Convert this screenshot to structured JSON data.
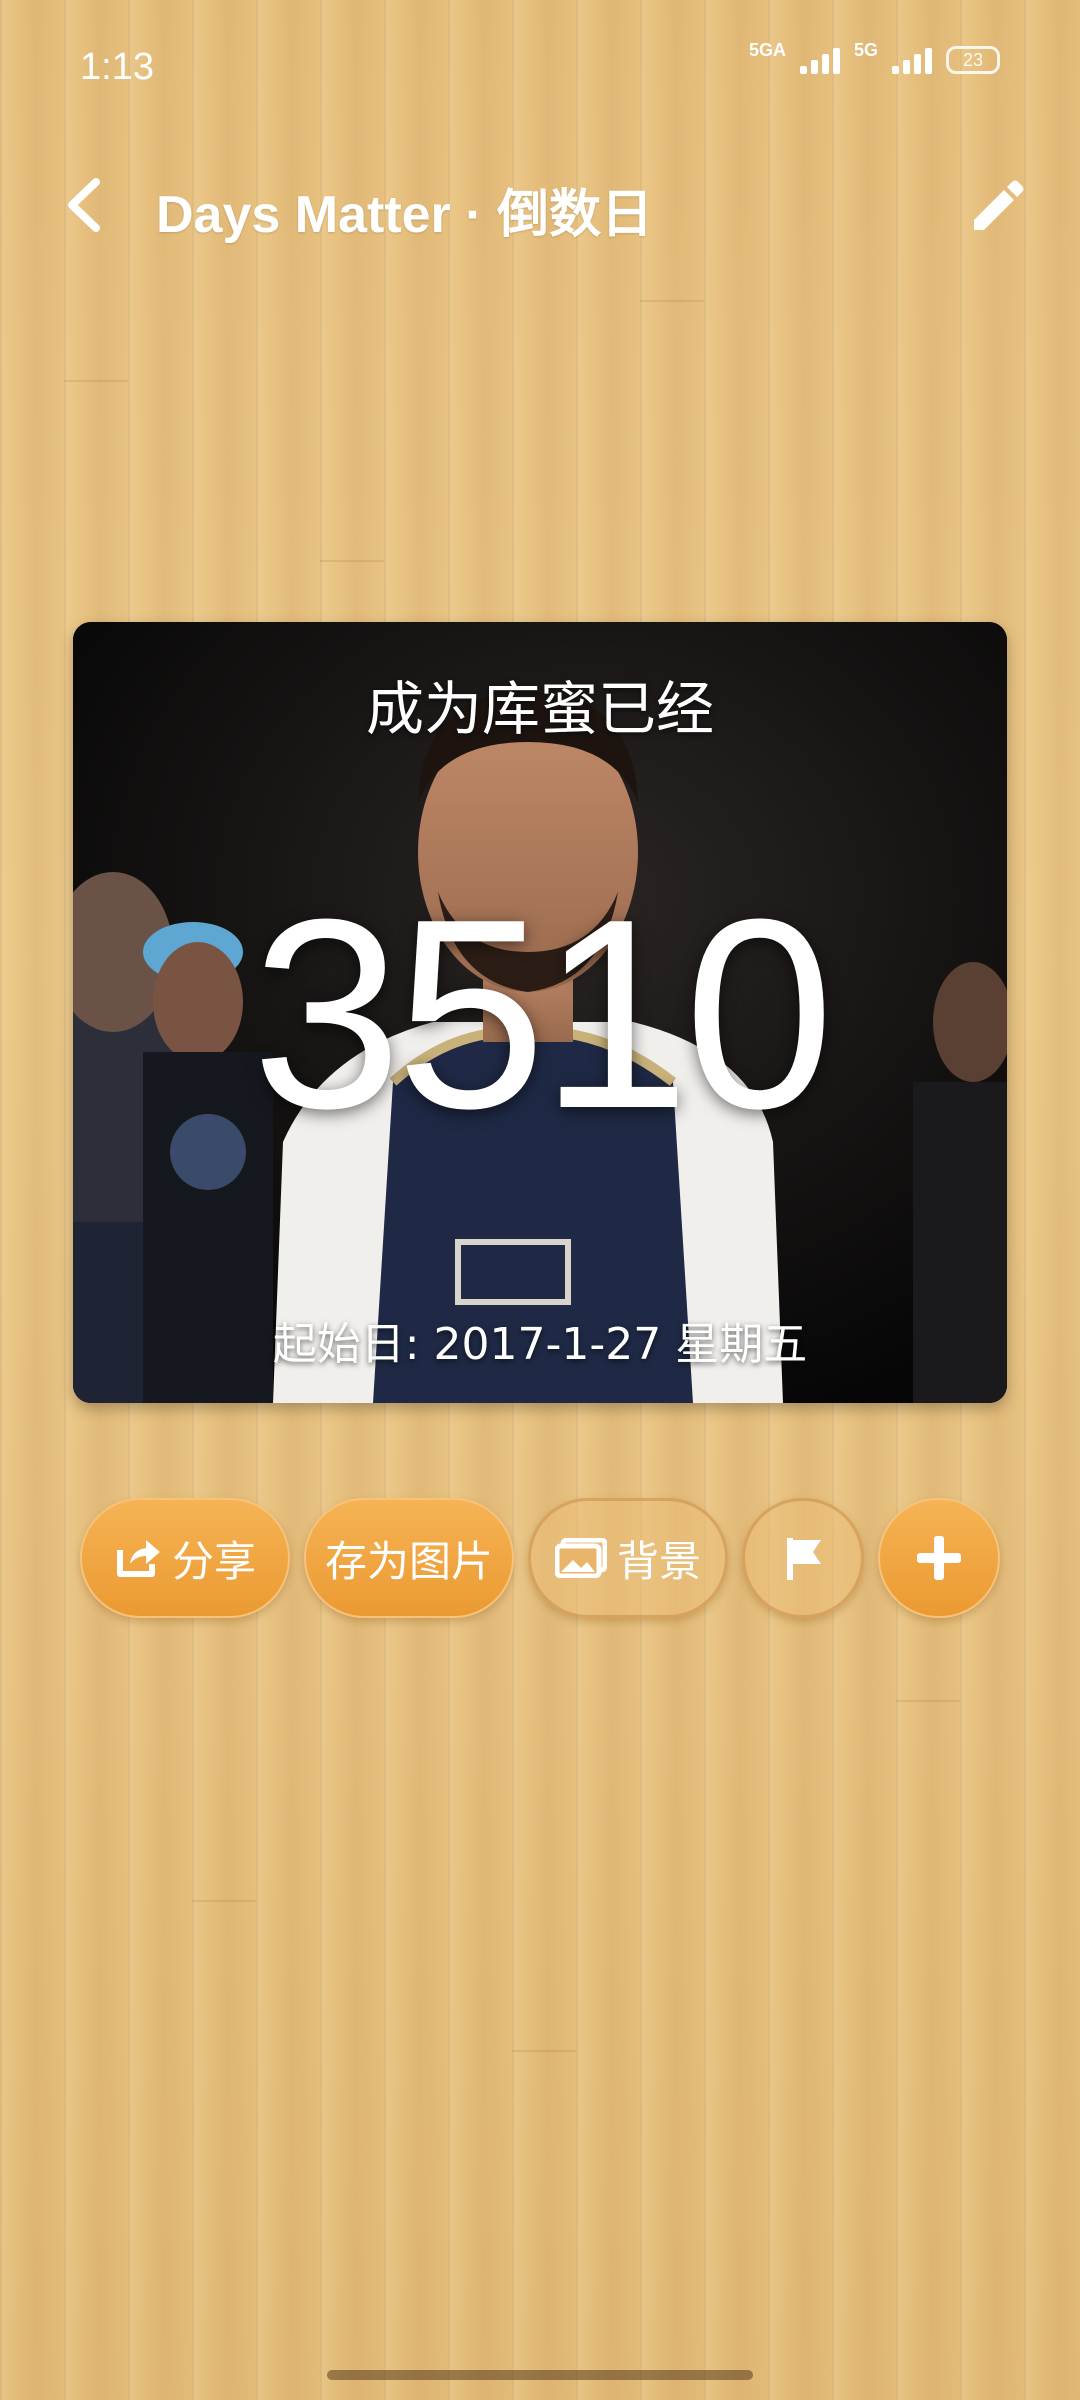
{
  "status_bar": {
    "time": "1:13",
    "network_1": "5GA",
    "network_2": "5G",
    "battery": "23"
  },
  "app_bar": {
    "title": "Days Matter · 倒数日",
    "back_icon": "chevron-left-icon",
    "edit_icon": "pencil-icon"
  },
  "card": {
    "title": "成为库蜜已经",
    "days": "3510",
    "start_date": "起始日: 2017-1-27 星期五"
  },
  "actions": {
    "share_label": "分享",
    "save_image_label": "存为图片",
    "background_label": "背景",
    "flag_icon": "flag-icon",
    "add_icon": "plus-icon"
  },
  "colors": {
    "accent": "#eb9a32",
    "wood": "#e6bf7d"
  }
}
